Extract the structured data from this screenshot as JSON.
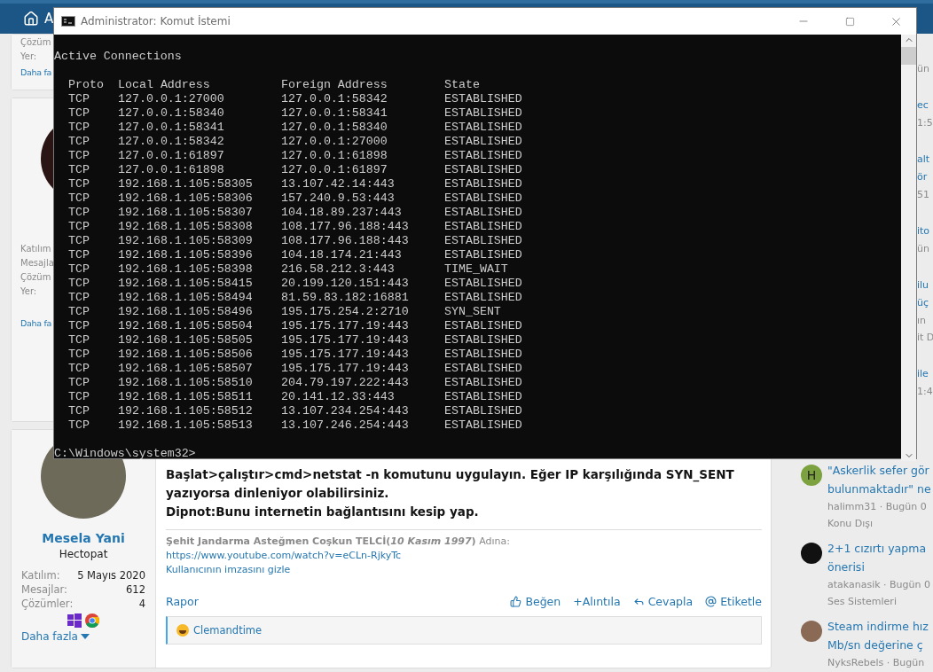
{
  "topbar": {
    "nav_fragment": "A"
  },
  "posts": [
    {
      "user": {
        "stat_labels": [
          "Çözüm",
          "Yer:"
        ],
        "more": "Daha fa"
      }
    },
    {
      "user": {
        "avatar": true,
        "stat_labels": [
          "Katılım",
          "Mesajla",
          "Çözüm",
          "Yer:"
        ],
        "more": "Daha fa"
      }
    },
    {
      "user": {
        "avatar": true,
        "name": "Mesela Yani",
        "rank": "Hectopat",
        "stats": [
          {
            "label": "Katılım:",
            "value": "5 Mayıs 2020"
          },
          {
            "label": "Mesajlar:",
            "value": "612"
          },
          {
            "label": "Çözümler:",
            "value": "4"
          }
        ],
        "more": "Daha fazla"
      },
      "body": [
        "**Başlat>çalıştır>cmd>netstat -n komutunu uygulayın. Eğer IP karşılığında SYN_SENT yazıyorsa dinleniyor olabilirsiniz.**",
        "**Dipnot:Bunu internetin bağlantısını kesip yap.**"
      ],
      "signature": {
        "text": "**Şehit Jandarma Asteğmen Coşkun TELCİ(*10 Kasım 1997*)** Adına:",
        "link": "https://www.youtube.com/watch?v=eCLn-RjkyTc",
        "hide": "Kullanıcının imzasını gizle"
      },
      "report": "Rapor",
      "actions": [
        {
          "kind": "like",
          "label": "Beğen"
        },
        {
          "kind": "quote",
          "label": "+Alıntıla"
        },
        {
          "kind": "reply",
          "label": "Cevapla"
        },
        {
          "kind": "mention",
          "label": "Etiketle"
        }
      ],
      "reactions": {
        "users": "Clemandtime"
      }
    }
  ],
  "sidebar": {
    "fragments": [
      {
        "meta": [
          "ün"
        ]
      },
      {
        "title": [
          "ec"
        ],
        "meta": [
          "1:5"
        ]
      },
      {
        "title": [
          "alt",
          "ör"
        ],
        "meta": [
          "51"
        ]
      },
      {
        "title": [
          "ito"
        ],
        "meta": [
          "ün"
        ]
      },
      {
        "title": [
          "ilu",
          "üç"
        ],
        "meta": [
          "ın",
          "it D"
        ]
      },
      {
        "title": [
          "ile"
        ],
        "meta": [
          "1:4"
        ]
      }
    ],
    "items": [
      {
        "avatar": {
          "kind": "letter",
          "letter": "H",
          "color": "#7ba23f"
        },
        "title": [
          "\"Askerlik sefer gör",
          "bulunmaktadır\" ne"
        ],
        "meta": "halimm31 · Bugün 0",
        "category": "Konu Dışı"
      },
      {
        "avatar": {
          "kind": "logo"
        },
        "title": [
          "2+1 cızırtı yapma",
          "önerisi"
        ],
        "meta": "atakanasik · Bugün 0",
        "category": "Ses Sistemleri"
      },
      {
        "avatar": {
          "kind": "photo"
        },
        "title": [
          "Steam indirme hız",
          "Mb/sn değerine ç"
        ],
        "meta": "NyksRebels · Bugün"
      }
    ]
  },
  "console": {
    "title": "Administrator: Komut İstemi",
    "heading": "Active Connections",
    "columns": [
      "Proto",
      "Local Address",
      "Foreign Address",
      "State"
    ],
    "rows": [
      [
        "TCP",
        "127.0.0.1:27000",
        "127.0.0.1:58342",
        "ESTABLISHED"
      ],
      [
        "TCP",
        "127.0.0.1:58340",
        "127.0.0.1:58341",
        "ESTABLISHED"
      ],
      [
        "TCP",
        "127.0.0.1:58341",
        "127.0.0.1:58340",
        "ESTABLISHED"
      ],
      [
        "TCP",
        "127.0.0.1:58342",
        "127.0.0.1:27000",
        "ESTABLISHED"
      ],
      [
        "TCP",
        "127.0.0.1:61897",
        "127.0.0.1:61898",
        "ESTABLISHED"
      ],
      [
        "TCP",
        "127.0.0.1:61898",
        "127.0.0.1:61897",
        "ESTABLISHED"
      ],
      [
        "TCP",
        "192.168.1.105:58305",
        "13.107.42.14:443",
        "ESTABLISHED"
      ],
      [
        "TCP",
        "192.168.1.105:58306",
        "157.240.9.53:443",
        "ESTABLISHED"
      ],
      [
        "TCP",
        "192.168.1.105:58307",
        "104.18.89.237:443",
        "ESTABLISHED"
      ],
      [
        "TCP",
        "192.168.1.105:58308",
        "108.177.96.188:443",
        "ESTABLISHED"
      ],
      [
        "TCP",
        "192.168.1.105:58309",
        "108.177.96.188:443",
        "ESTABLISHED"
      ],
      [
        "TCP",
        "192.168.1.105:58396",
        "104.18.174.21:443",
        "ESTABLISHED"
      ],
      [
        "TCP",
        "192.168.1.105:58398",
        "216.58.212.3:443",
        "TIME_WAIT"
      ],
      [
        "TCP",
        "192.168.1.105:58415",
        "20.199.120.151:443",
        "ESTABLISHED"
      ],
      [
        "TCP",
        "192.168.1.105:58494",
        "81.59.83.182:16881",
        "ESTABLISHED"
      ],
      [
        "TCP",
        "192.168.1.105:58496",
        "195.175.254.2:2710",
        "SYN_SENT"
      ],
      [
        "TCP",
        "192.168.1.105:58504",
        "195.175.177.19:443",
        "ESTABLISHED"
      ],
      [
        "TCP",
        "192.168.1.105:58505",
        "195.175.177.19:443",
        "ESTABLISHED"
      ],
      [
        "TCP",
        "192.168.1.105:58506",
        "195.175.177.19:443",
        "ESTABLISHED"
      ],
      [
        "TCP",
        "192.168.1.105:58507",
        "195.175.177.19:443",
        "ESTABLISHED"
      ],
      [
        "TCP",
        "192.168.1.105:58510",
        "204.79.197.222:443",
        "ESTABLISHED"
      ],
      [
        "TCP",
        "192.168.1.105:58511",
        "20.141.12.33:443",
        "ESTABLISHED"
      ],
      [
        "TCP",
        "192.168.1.105:58512",
        "13.107.234.254:443",
        "ESTABLISHED"
      ],
      [
        "TCP",
        "192.168.1.105:58513",
        "13.107.246.254:443",
        "ESTABLISHED"
      ]
    ],
    "prompt": "C:\\Windows\\system32>"
  }
}
